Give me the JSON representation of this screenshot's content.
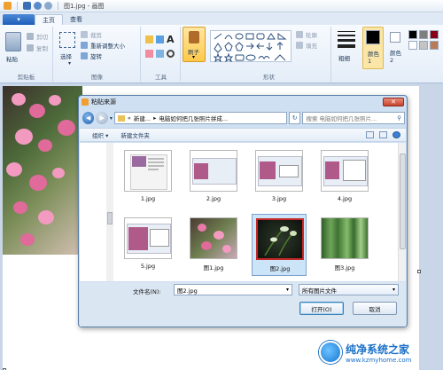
{
  "window": {
    "title": "图1.jpg - 画图"
  },
  "ribbon": {
    "menu_label": "",
    "tabs": [
      {
        "label": "主页",
        "active": true
      },
      {
        "label": "查看",
        "active": false
      }
    ],
    "groups": {
      "clipboard": {
        "label": "剪贴板",
        "paste": "粘贴",
        "cut": "剪切",
        "copy": "复制"
      },
      "image": {
        "label": "图像",
        "select": "选择",
        "crop": "裁剪",
        "resize": "重新调整大小",
        "rotate": "旋转"
      },
      "tools": {
        "label": "工具"
      },
      "brushes": {
        "label": "刷子"
      },
      "shapes": {
        "label": "形状",
        "outline": "轮廓",
        "fill": "填充"
      },
      "size": {
        "label": "粗细"
      },
      "colors": {
        "color1": "颜色 1",
        "color2": "颜色 2"
      }
    }
  },
  "dialog": {
    "title": "粘贴来源",
    "close_label": "✕",
    "address": {
      "prefix": "«",
      "crumb1": "新建...",
      "crumb2": "电脑如何把几张照片拼成..."
    },
    "search_placeholder": "搜索 电脑如何把几张照片...",
    "toolbar": {
      "organize": "组织 ▾",
      "new_folder": "新建文件夹"
    },
    "files": [
      {
        "name": "1.jpg",
        "kind": "screenshot"
      },
      {
        "name": "2.jpg",
        "kind": "screenshot"
      },
      {
        "name": "3.jpg",
        "kind": "screenshot"
      },
      {
        "name": "4.jpg",
        "kind": "screenshot"
      },
      {
        "name": "5.jpg",
        "kind": "screenshot"
      },
      {
        "name": "图1.jpg",
        "kind": "blossom"
      },
      {
        "name": "图2.jpg",
        "kind": "orchid",
        "selected": true
      },
      {
        "name": "图3.jpg",
        "kind": "bamboo"
      }
    ],
    "filename_label": "文件名(N):",
    "filename_value": "图2.jpg",
    "filter_value": "所有图片文件",
    "open_label": "打开(O)",
    "cancel_label": "取消"
  },
  "watermark": {
    "main": "纯净系统之家",
    "url": "www.kzmyhome.com"
  },
  "colors": {
    "accent": "#1f5fb8",
    "selection_frame": "#c62828",
    "color1": "#000000",
    "color2": "#ffffff"
  }
}
